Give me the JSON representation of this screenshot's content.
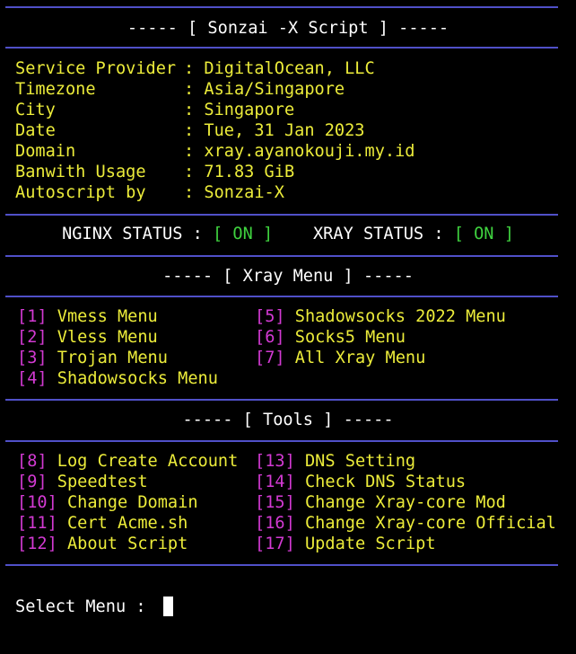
{
  "header": {
    "title": "----- [ Sonzai -X Script ] -----"
  },
  "info": [
    {
      "key": "Service Provider",
      "value": ": DigitalOcean, LLC"
    },
    {
      "key": "Timezone",
      "value": ": Asia/Singapore"
    },
    {
      "key": "City",
      "value": ": Singapore"
    },
    {
      "key": "Date",
      "value": ": Tue, 31 Jan 2023"
    },
    {
      "key": "Domain",
      "value": ": xray.ayanokouji.my.id"
    },
    {
      "key": "Banwith Usage",
      "value": ": 71.83 GiB"
    },
    {
      "key": "Autoscript by",
      "value": ": Sonzai-X"
    }
  ],
  "status": {
    "nginx_label": "NGINX STATUS : ",
    "nginx_value": "[ ON ]",
    "xray_label": "XRAY STATUS : ",
    "xray_value": "[ ON ]"
  },
  "xray_menu": {
    "title": "----- [ Xray Menu ] -----",
    "items": [
      {
        "num": "[1]",
        "label": "Vmess Menu"
      },
      {
        "num": "[2]",
        "label": "Vless Menu"
      },
      {
        "num": "[3]",
        "label": "Trojan Menu"
      },
      {
        "num": "[4]",
        "label": "Shadowsocks Menu"
      },
      {
        "num": "[5]",
        "label": "Shadowsocks 2022 Menu"
      },
      {
        "num": "[6]",
        "label": "Socks5 Menu"
      },
      {
        "num": "[7]",
        "label": "All Xray Menu"
      }
    ]
  },
  "tools": {
    "title": "----- [ Tools ] -----",
    "items": [
      {
        "num": "[8]",
        "label": "Log Create Account"
      },
      {
        "num": "[9]",
        "label": "Speedtest"
      },
      {
        "num": "[10]",
        "label": "Change Domain"
      },
      {
        "num": "[11]",
        "label": "Cert Acme.sh"
      },
      {
        "num": "[12]",
        "label": "About Script"
      },
      {
        "num": "[13]",
        "label": "DNS Setting"
      },
      {
        "num": "[14]",
        "label": "Check DNS Status"
      },
      {
        "num": "[15]",
        "label": "Change Xray-core Mod"
      },
      {
        "num": "[16]",
        "label": "Change Xray-core Official"
      },
      {
        "num": "[17]",
        "label": "Update Script"
      }
    ]
  },
  "prompt": {
    "label": "Select Menu : "
  },
  "colors": {
    "background": "#000000",
    "separator": "#5050c8",
    "info_text": "#ecec3a",
    "menu_number": "#d33ad3",
    "menu_label": "#ecec3a",
    "status_on": "#3fd23f",
    "text": "#ffffff"
  }
}
